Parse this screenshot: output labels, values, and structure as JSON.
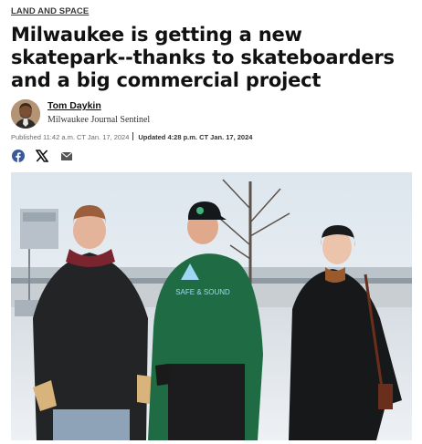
{
  "article": {
    "section_label": "LAND AND SPACE",
    "headline": "Milwaukee is getting a new skatepark--thanks to skateboarders and a big commercial project",
    "author": {
      "name": "Tom Daykin",
      "publication": "Milwaukee Journal Sentinel"
    },
    "published": "Published 11:42 a.m. CT Jan. 17, 2024",
    "updated": "Updated 4:28 p.m. CT Jan. 17, 2024"
  },
  "share": {
    "icons": [
      "facebook-icon",
      "x-icon",
      "email-icon"
    ]
  },
  "photo": {
    "sweatshirt_text": "SAFE & SOUND"
  },
  "colors": {
    "facebook": "#3b5998",
    "text": "#111111",
    "muted": "#6a6a6a"
  }
}
